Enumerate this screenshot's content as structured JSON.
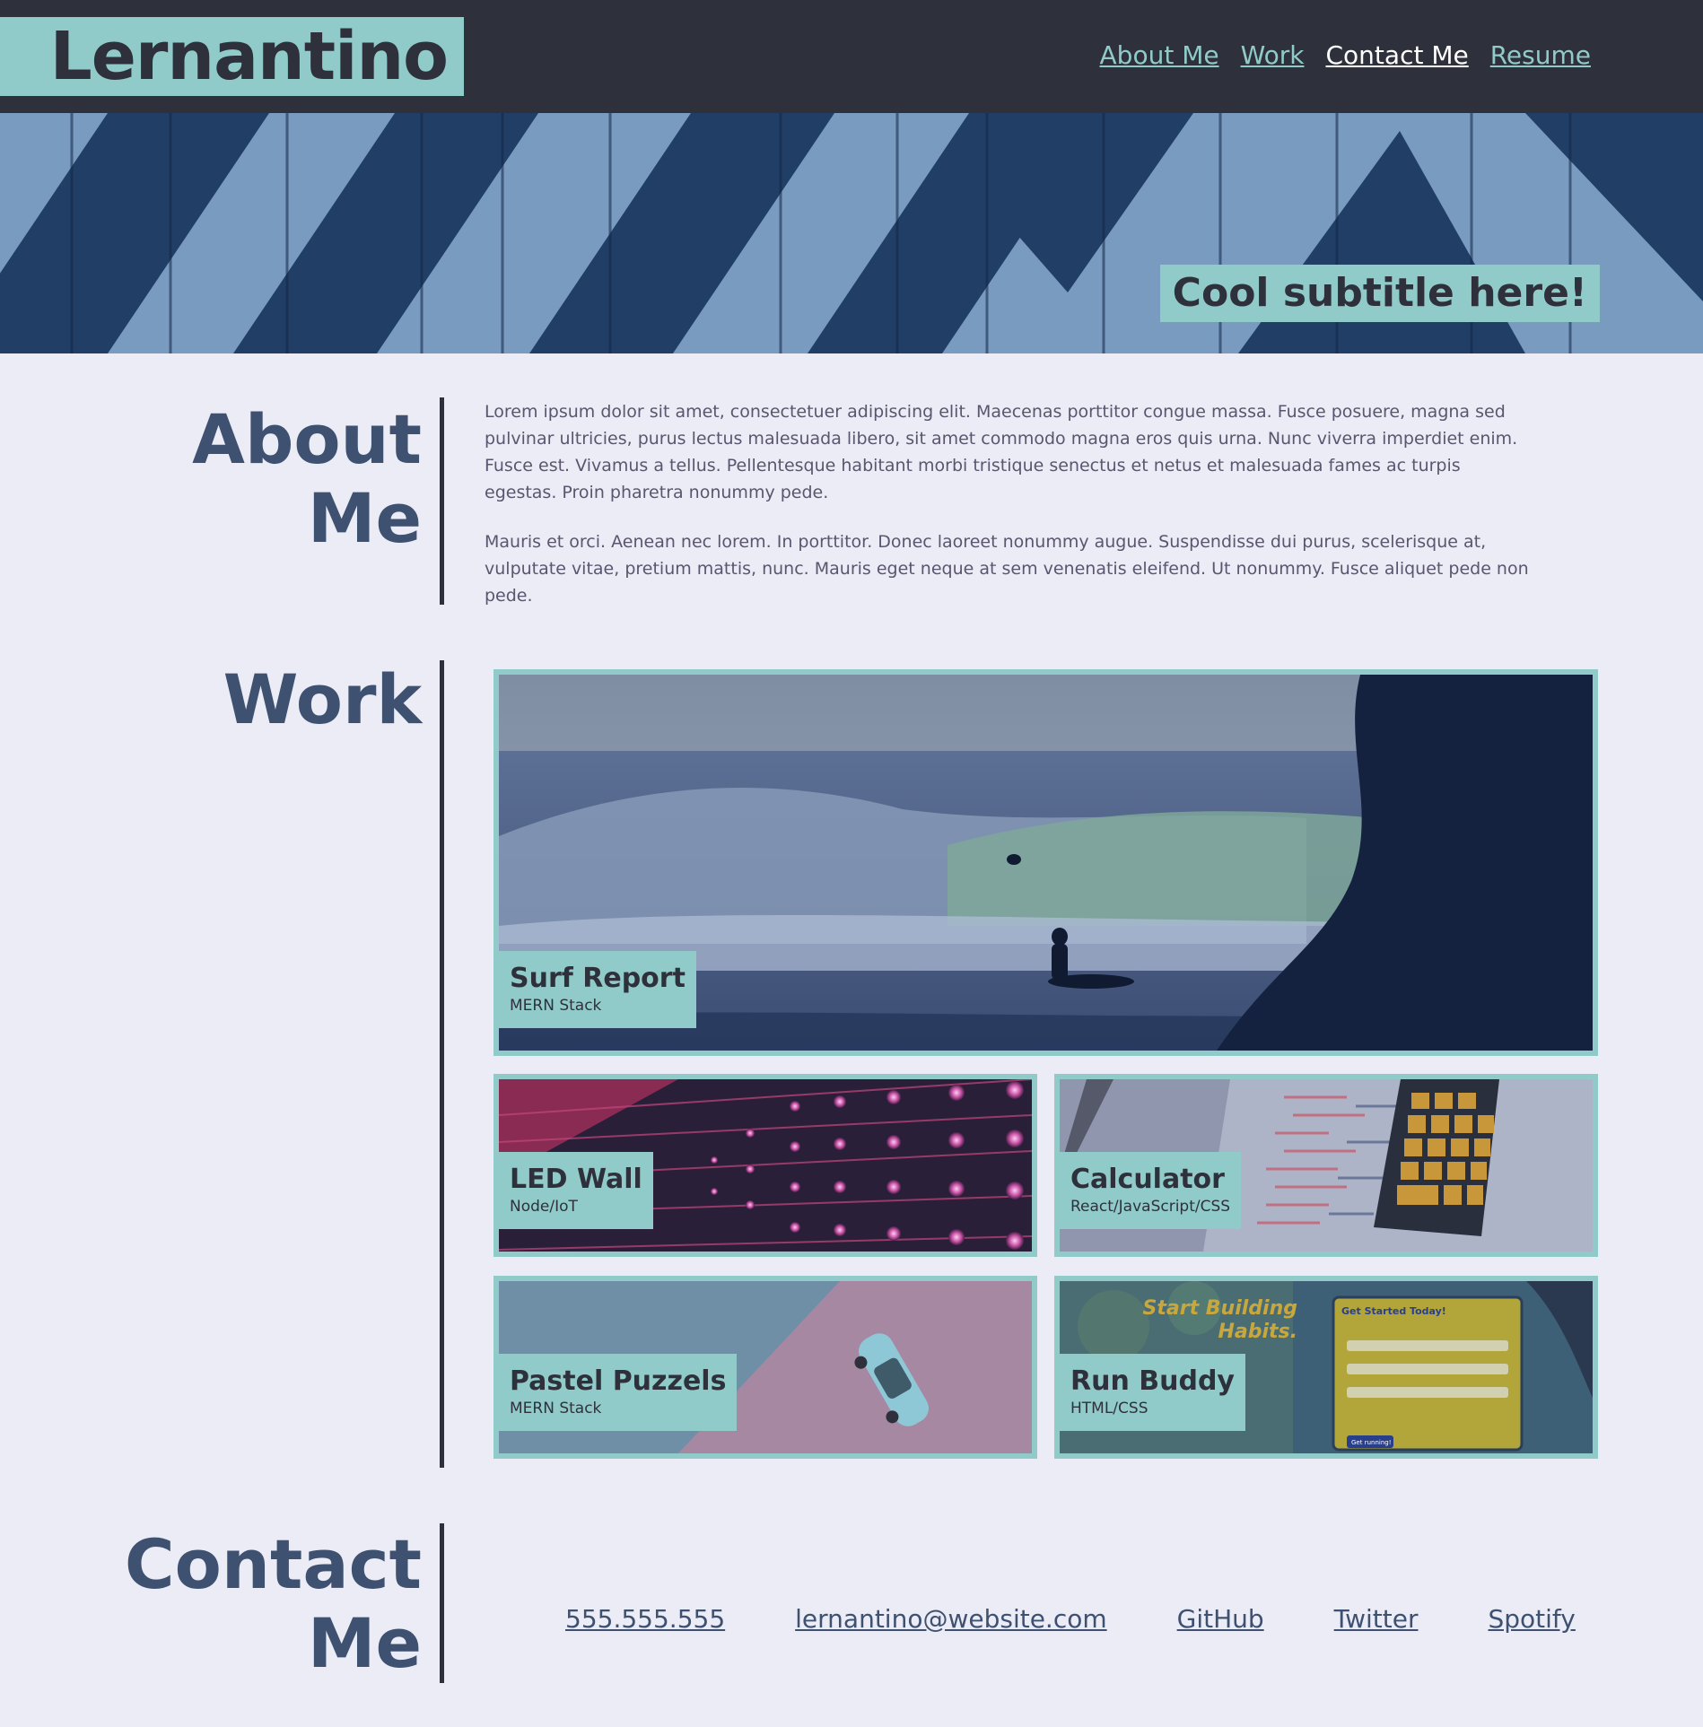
{
  "header": {
    "logo": "Lernantino",
    "nav": [
      "About Me",
      "Work",
      "Contact Me",
      "Resume"
    ]
  },
  "hero": {
    "subtitle": "Cool subtitle here!"
  },
  "about": {
    "title_line1": "About",
    "title_line2": "Me",
    "paragraphs": [
      "Lorem ipsum dolor sit amet, consectetuer adipiscing elit. Maecenas porttitor congue massa. Fusce posuere, magna sed pulvinar ultricies, purus lectus malesuada libero, sit amet commodo magna eros quis urna. Nunc viverra imperdiet enim. Fusce est. Vivamus a tellus. Pellentesque habitant morbi tristique senectus et netus et malesuada fames ac turpis egestas. Proin pharetra nonummy pede.",
      "Mauris et orci. Aenean nec lorem. In porttitor. Donec laoreet nonummy augue. Suspendisse dui purus, scelerisque at, vulputate vitae, pretium mattis, nunc. Mauris eget neque at sem venenatis eleifend. Ut nonummy. Fusce aliquet pede non pede."
    ]
  },
  "work": {
    "title": "Work",
    "projects": [
      {
        "name": "Surf Report",
        "stack": "MERN Stack"
      },
      {
        "name": "LED Wall",
        "stack": "Node/IoT"
      },
      {
        "name": "Calculator",
        "stack": "React/JavaScript/CSS"
      },
      {
        "name": "Pastel Puzzels",
        "stack": "MERN Stack"
      },
      {
        "name": "Run Buddy",
        "stack": "HTML/CSS"
      }
    ],
    "run_buddy_preview": {
      "headline1": "Start Building",
      "headline2": "Habits.",
      "form_title": "Get Started Today!",
      "form_button": "Get running!"
    }
  },
  "contact": {
    "title_line1": "Contact",
    "title_line2": "Me",
    "links": [
      "555.555.555",
      "lernantino@website.com",
      "GitHub",
      "Twitter",
      "Spotify"
    ]
  },
  "colors": {
    "header_bg": "#2e313c",
    "accent": "#91cbc9",
    "page_bg": "#ebecf5",
    "heading": "#3f5171"
  }
}
